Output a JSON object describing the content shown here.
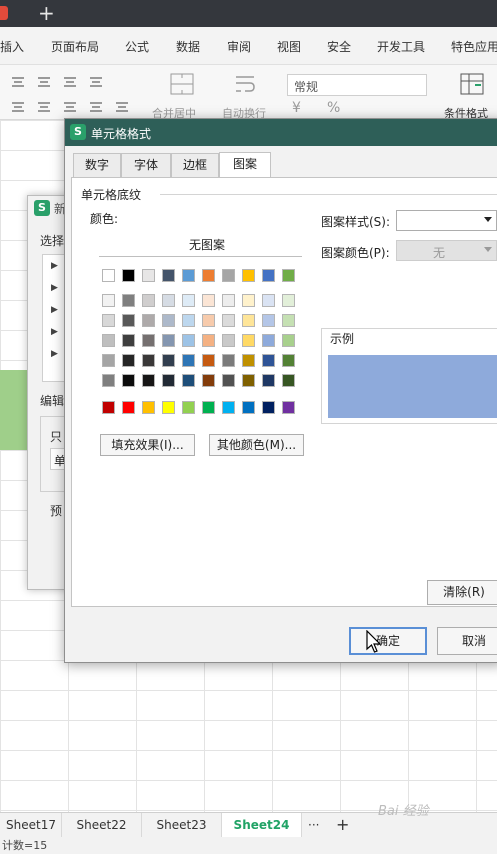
{
  "ribbon": {
    "menu": [
      "插入",
      "页面布局",
      "公式",
      "数据",
      "审阅",
      "视图",
      "安全",
      "开发工具",
      "特色应用"
    ],
    "merge_center": "合并居中",
    "wrap_text": "自动换行",
    "number_format": "常规",
    "cond_format": "条件格式",
    "percent_symbol": "%"
  },
  "bg_dialog": {
    "title": "新",
    "select_label": "选择",
    "edit_label": "编辑",
    "only_label": "只",
    "single_label": "单",
    "preview_label": "预"
  },
  "dialog": {
    "title": "单元格格式",
    "tabs": [
      "数字",
      "字体",
      "边框",
      "图案"
    ],
    "active_tab": "图案",
    "shading_section": "单元格底纹",
    "color_label": "颜色:",
    "no_pattern": "无图案",
    "fill_effects_button": "填充效果(I)...",
    "more_colors_button": "其他颜色(M)...",
    "pattern_style_label": "图案样式(S):",
    "pattern_color_label": "图案颜色(P):",
    "pattern_color_value": "无",
    "sample_label": "示例",
    "sample_color": "#8eaadb",
    "clear_button": "清除(R)",
    "ok_button": "确定",
    "cancel_button": "取消"
  },
  "palette": {
    "theme_row": [
      "#ffffff",
      "#000000",
      "#e7e6e6",
      "#44546a",
      "#5b9bd5",
      "#ed7d31",
      "#a5a5a5",
      "#ffc000",
      "#4472c4",
      "#70ad47"
    ],
    "tint_rows": [
      [
        "#f2f2f2",
        "#7f7f7f",
        "#d0cece",
        "#d6dce4",
        "#deebf6",
        "#fbe5d5",
        "#ededed",
        "#fff2cc",
        "#dae3f3",
        "#e2efd9"
      ],
      [
        "#d8d8d8",
        "#595959",
        "#aeaaaa",
        "#adb9ca",
        "#bdd7ee",
        "#f7cbac",
        "#dbdbdb",
        "#fee599",
        "#b4c6e7",
        "#c5e0b3"
      ],
      [
        "#bfbfbf",
        "#3f3f3f",
        "#757070",
        "#8496b0",
        "#9dc3e6",
        "#f4b183",
        "#c9c9c9",
        "#ffd965",
        "#8eaadb",
        "#a8d08d"
      ],
      [
        "#a5a5a5",
        "#262626",
        "#3a3838",
        "#323f4f",
        "#2e75b5",
        "#c55a11",
        "#7b7b7b",
        "#bf9000",
        "#2f5496",
        "#538135"
      ],
      [
        "#7f7f7f",
        "#0c0c0c",
        "#171616",
        "#222a35",
        "#1e4e79",
        "#833c0b",
        "#525252",
        "#7f6000",
        "#1f3864",
        "#375623"
      ]
    ],
    "standard_row": [
      "#c00000",
      "#ff0000",
      "#ffc000",
      "#ffff00",
      "#92d050",
      "#00b050",
      "#00b0f0",
      "#0070c0",
      "#002060",
      "#7030a0"
    ],
    "selected": "#8eaadb"
  },
  "sheet_tabs": [
    "Sheet17",
    "Sheet22",
    "Sheet23",
    "Sheet24"
  ],
  "active_sheet": "Sheet24",
  "more_sheets": "···",
  "add_sheet": "+",
  "new_tab_plus": "+",
  "status": "计数=15"
}
